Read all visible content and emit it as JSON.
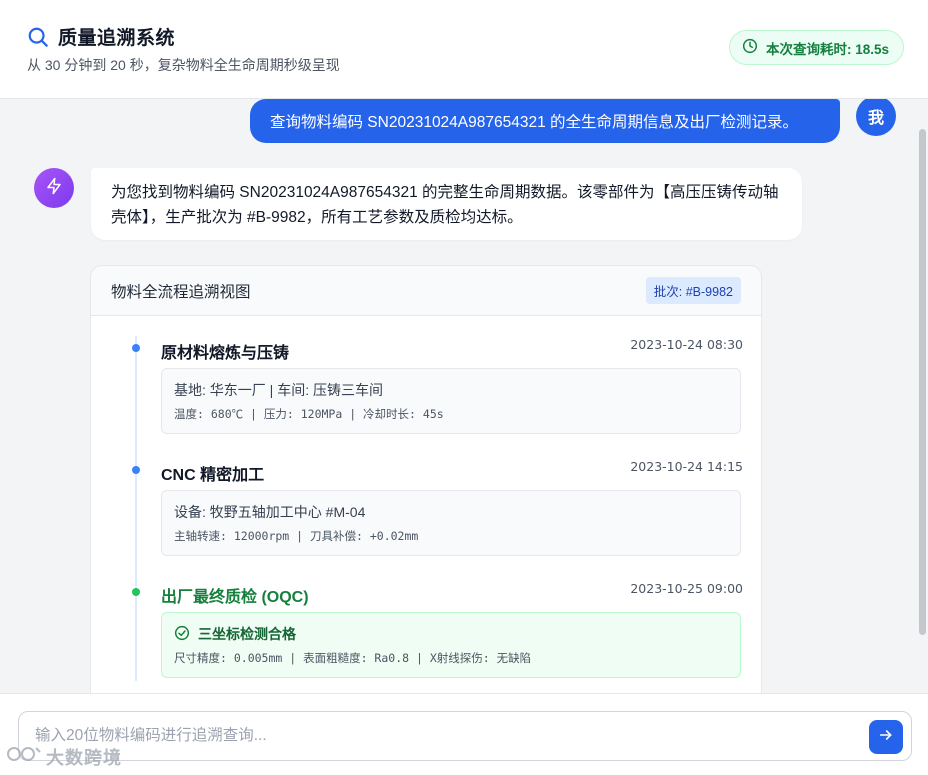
{
  "header": {
    "title": "质量追溯系统",
    "subtitle": "从 30 分钟到 20 秒，复杂物料全生命周期秒级呈现",
    "timing_badge": "本次查询耗时: 18.5s"
  },
  "chat": {
    "user_message": "查询物料编码 SN20231024A987654321 的全生命周期信息及出厂检测记录。",
    "user_avatar": "我",
    "bot_message": "为您找到物料编码 SN20231024A987654321 的完整生命周期数据。该零部件为【高压压铸传动轴壳体】，生产批次为 #B-9982，所有工艺参数及质检均达标。"
  },
  "trace_card": {
    "title": "物料全流程追溯视图",
    "batch_tag": "批次: #B-9982",
    "steps": [
      {
        "name": "原材料熔炼与压铸",
        "time": "2023-10-24 08:30",
        "main": "基地: 华东一厂 | 车间: 压铸三车间",
        "sub": "温度: 680℃ | 压力: 120MPa | 冷却时长: 45s"
      },
      {
        "name": "CNC 精密加工",
        "time": "2023-10-24 14:15",
        "main": "设备: 牧野五轴加工中心 #M-04",
        "sub": "主轴转速: 12000rpm | 刀具补偿: +0.02mm"
      },
      {
        "name": "出厂最终质检 (OQC)",
        "time": "2023-10-25 09:00",
        "main": "三坐标检测合格",
        "sub": "尺寸精度: 0.005mm | 表面粗糙度: Ra0.8 | X射线探伤: 无缺陷"
      }
    ]
  },
  "input": {
    "placeholder": "输入20位物料编码进行追溯查询...",
    "value": ""
  },
  "watermark": "大数跨境",
  "icons": {
    "title": "search-icon",
    "timing": "clock-icon",
    "bot": "lightning-icon",
    "pass": "check-circle-icon",
    "send": "arrow-right-icon"
  },
  "colors": {
    "primary": "#2563eb",
    "success": "#15803d",
    "bot_accent": "#8b5cf6"
  }
}
